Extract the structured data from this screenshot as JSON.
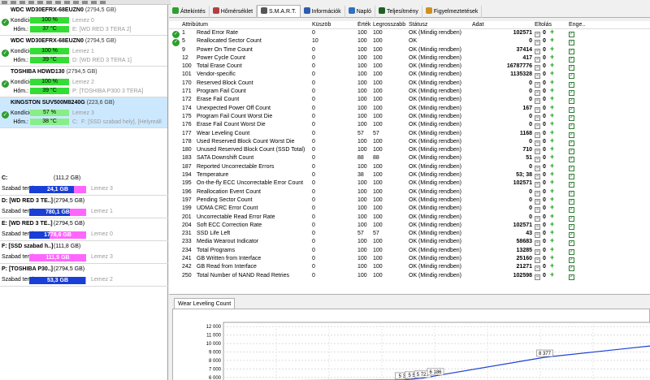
{
  "disks": [
    {
      "name": "WDC WD30EFRX-68EUZN0",
      "size": "(2794,5 GB)",
      "health_label": "Kondíció:",
      "health": "100 %",
      "temp_label": "Hőm.:",
      "temp": "37 °C",
      "disk_no": "Lemez 0",
      "vol": "E: [WD RED 3 TERA 2]",
      "selected": false
    },
    {
      "name": "WDC WD30EFRX-68EUZN0",
      "size": "(2794,5 GB)",
      "health_label": "Kondíció:",
      "health": "100 %",
      "temp_label": "Hőm.:",
      "temp": "39 °C",
      "disk_no": "Lemez 1",
      "vol": "D: [WD RED 3 TERA 1]",
      "selected": false
    },
    {
      "name": "TOSHIBA HDWD130",
      "size": "(2794,5 GB)",
      "health_label": "Kondíció:",
      "health": "100 %",
      "temp_label": "Hőm.:",
      "temp": "39 °C",
      "disk_no": "Lemez 2",
      "vol": "P: [TOSHIBA P300 3 TERA]",
      "selected": false
    },
    {
      "name": "KINGSTON SUV500M8240G",
      "size": "(223,6 GB)",
      "health_label": "Kondíció:",
      "health": "57 %",
      "temp_label": "Hőm.:",
      "temp": "38 °C",
      "disk_no": "Lemez 3",
      "vol": "C:",
      "vol2": "F: [SSD szabad hely],  [Helyreáll",
      "selected": true
    }
  ],
  "volumes": [
    {
      "name": "C:",
      "size": "(111,2 GB)",
      "free_label": "Szabad terület",
      "free": "24,1 GB",
      "used_fraction": 0.78,
      "disk": "Lemez 3"
    },
    {
      "name": "D: [WD RED 3 TE..]",
      "size": "(2794,5 GB)",
      "free_label": "Szabad terület",
      "free": "780,1 GB",
      "used_fraction": 0.72,
      "disk": "Lemez 1"
    },
    {
      "name": "E: [WD RED 3 TE..]",
      "size": "(2794,5 GB)",
      "free_label": "Szabad terület",
      "free": "1778,6 GB",
      "used_fraction": 0.36,
      "disk": "Lemez 0"
    },
    {
      "name": "F: [SSD szabad h..]",
      "size": "(111,8 GB)",
      "free_label": "Szabad terület",
      "free": "111,5 GB",
      "used_fraction": 0.0,
      "disk": "Lemez 3"
    },
    {
      "name": "P: [TOSHIBA P30..]",
      "size": "(2794,5 GB)",
      "free_label": "Szabad terület",
      "free": "53,3 GB",
      "used_fraction": 0.98,
      "disk": "Lemez 2"
    }
  ],
  "tabs": [
    {
      "label": "Áttekintés",
      "icon": "overview-icon",
      "color": "#2e9e2e"
    },
    {
      "label": "Hőmérséklet",
      "icon": "thermometer-icon",
      "color": "#b04040"
    },
    {
      "label": "S.M.A.R.T.",
      "icon": "smart-icon",
      "color": "#555555",
      "active": true
    },
    {
      "label": "Információk",
      "icon": "info-icon",
      "color": "#2a5db0"
    },
    {
      "label": "Napló",
      "icon": "log-icon",
      "color": "#3070c0"
    },
    {
      "label": "Teljesítmény",
      "icon": "performance-icon",
      "color": "#206020"
    },
    {
      "label": "Figyelmeztetések",
      "icon": "warnings-icon",
      "color": "#d09020"
    }
  ],
  "columns": {
    "attr": "Attribútum",
    "raw": "Küszöb",
    "value": "Érték",
    "worst": "Legrosszabb",
    "status": "Státusz",
    "data": "Adat",
    "offset": "Eltolás",
    "enabled": "Enge..."
  },
  "attributes": [
    {
      "id": "1",
      "name": "Read Error Rate",
      "thr": "0",
      "val": "100",
      "worst": "100",
      "status": "OK (Mindig rendben)",
      "data": "102571",
      "ok": true
    },
    {
      "id": "5",
      "name": "Reallocated Sector Count",
      "thr": "10",
      "val": "100",
      "worst": "100",
      "status": "OK",
      "data": "0",
      "ok": true
    },
    {
      "id": "9",
      "name": "Power On Time Count",
      "thr": "0",
      "val": "100",
      "worst": "100",
      "status": "OK (Mindig rendben)",
      "data": "37414"
    },
    {
      "id": "12",
      "name": "Power Cycle Count",
      "thr": "0",
      "val": "100",
      "worst": "100",
      "status": "OK (Mindig rendben)",
      "data": "417"
    },
    {
      "id": "100",
      "name": "Total Erase Count",
      "thr": "0",
      "val": "100",
      "worst": "100",
      "status": "OK (Mindig rendben)",
      "data": "16787776"
    },
    {
      "id": "101",
      "name": "Vendor-specific",
      "thr": "0",
      "val": "100",
      "worst": "100",
      "status": "OK (Mindig rendben)",
      "data": "1135328"
    },
    {
      "id": "170",
      "name": "Reserved Block Count",
      "thr": "0",
      "val": "100",
      "worst": "100",
      "status": "OK (Mindig rendben)",
      "data": "0"
    },
    {
      "id": "171",
      "name": "Program Fail Count",
      "thr": "0",
      "val": "100",
      "worst": "100",
      "status": "OK (Mindig rendben)",
      "data": "0"
    },
    {
      "id": "172",
      "name": "Erase Fail Count",
      "thr": "0",
      "val": "100",
      "worst": "100",
      "status": "OK (Mindig rendben)",
      "data": "0"
    },
    {
      "id": "174",
      "name": "Unexpected Power Off Count",
      "thr": "0",
      "val": "100",
      "worst": "100",
      "status": "OK (Mindig rendben)",
      "data": "167"
    },
    {
      "id": "175",
      "name": "Program Fail Count Worst Die",
      "thr": "0",
      "val": "100",
      "worst": "100",
      "status": "OK (Mindig rendben)",
      "data": "0"
    },
    {
      "id": "176",
      "name": "Erase Fail Count Worst Die",
      "thr": "0",
      "val": "100",
      "worst": "100",
      "status": "OK (Mindig rendben)",
      "data": "0"
    },
    {
      "id": "177",
      "name": "Wear Leveling Count",
      "thr": "0",
      "val": "57",
      "worst": "57",
      "status": "OK (Mindig rendben)",
      "data": "1168"
    },
    {
      "id": "178",
      "name": "Used Reserved Block Count Worst Die",
      "thr": "0",
      "val": "100",
      "worst": "100",
      "status": "OK (Mindig rendben)",
      "data": "0"
    },
    {
      "id": "180",
      "name": "Unused Reserved Block Count (SSD Total)",
      "thr": "0",
      "val": "100",
      "worst": "100",
      "status": "OK (Mindig rendben)",
      "data": "710"
    },
    {
      "id": "183",
      "name": "SATA Downshift Count",
      "thr": "0",
      "val": "88",
      "worst": "88",
      "status": "OK (Mindig rendben)",
      "data": "51"
    },
    {
      "id": "187",
      "name": "Reported Uncorrectable Errors",
      "thr": "0",
      "val": "100",
      "worst": "100",
      "status": "OK (Mindig rendben)",
      "data": "0"
    },
    {
      "id": "194",
      "name": "Temperature",
      "thr": "0",
      "val": "38",
      "worst": "100",
      "status": "OK (Mindig rendben)",
      "data": "53; 38"
    },
    {
      "id": "195",
      "name": "On-the-fly ECC Uncorrectable Error Count",
      "thr": "0",
      "val": "100",
      "worst": "100",
      "status": "OK (Mindig rendben)",
      "data": "102571"
    },
    {
      "id": "196",
      "name": "Reallocation Event Count",
      "thr": "0",
      "val": "100",
      "worst": "100",
      "status": "OK (Mindig rendben)",
      "data": "0"
    },
    {
      "id": "197",
      "name": "Pending Sector Count",
      "thr": "0",
      "val": "100",
      "worst": "100",
      "status": "OK (Mindig rendben)",
      "data": "0"
    },
    {
      "id": "199",
      "name": "UDMA CRC Error Count",
      "thr": "0",
      "val": "100",
      "worst": "100",
      "status": "OK (Mindig rendben)",
      "data": "0"
    },
    {
      "id": "201",
      "name": "Uncorrectable Read Error Rate",
      "thr": "0",
      "val": "100",
      "worst": "100",
      "status": "OK (Mindig rendben)",
      "data": "0"
    },
    {
      "id": "204",
      "name": "Soft ECC Correction Rate",
      "thr": "0",
      "val": "100",
      "worst": "100",
      "status": "OK (Mindig rendben)",
      "data": "102571"
    },
    {
      "id": "231",
      "name": "SSD Life Left",
      "thr": "0",
      "val": "57",
      "worst": "57",
      "status": "OK (Mindig rendben)",
      "data": "43"
    },
    {
      "id": "233",
      "name": "Media Wearout Indicator",
      "thr": "0",
      "val": "100",
      "worst": "100",
      "status": "OK (Mindig rendben)",
      "data": "58683"
    },
    {
      "id": "234",
      "name": "Total Programs",
      "thr": "0",
      "val": "100",
      "worst": "100",
      "status": "OK (Mindig rendben)",
      "data": "13285"
    },
    {
      "id": "241",
      "name": "GB Written from Interface",
      "thr": "0",
      "val": "100",
      "worst": "100",
      "status": "OK (Mindig rendben)",
      "data": "25160"
    },
    {
      "id": "242",
      "name": "GB Read from Interface",
      "thr": "0",
      "val": "100",
      "worst": "100",
      "status": "OK (Mindig rendben)",
      "data": "21271"
    },
    {
      "id": "250",
      "name": "Total Number of NAND Read Retries",
      "thr": "0",
      "val": "100",
      "worst": "100",
      "status": "OK (Mindig rendben)",
      "data": "102598"
    }
  ],
  "offset_value": "0",
  "chart_tab": "Wear Leveling Count",
  "chart_data": {
    "type": "line",
    "title": "",
    "y_ticks": [
      "12 000",
      "11 000",
      "10 000",
      "9 000",
      "8 000",
      "7 000",
      "6 000"
    ],
    "ylim": [
      5500,
      12500
    ],
    "series": [
      {
        "values": [
          5600,
          5700,
          5800,
          5900,
          6186,
          8377,
          9800
        ],
        "labels": [
          "",
          "5 3..",
          "5 5..",
          "5 72..",
          "6 186",
          "8 377",
          ""
        ]
      }
    ],
    "x": [
      0,
      0.56,
      0.59,
      0.62,
      0.66,
      1.0,
      1.35
    ],
    "color": "#1a3fd6"
  }
}
